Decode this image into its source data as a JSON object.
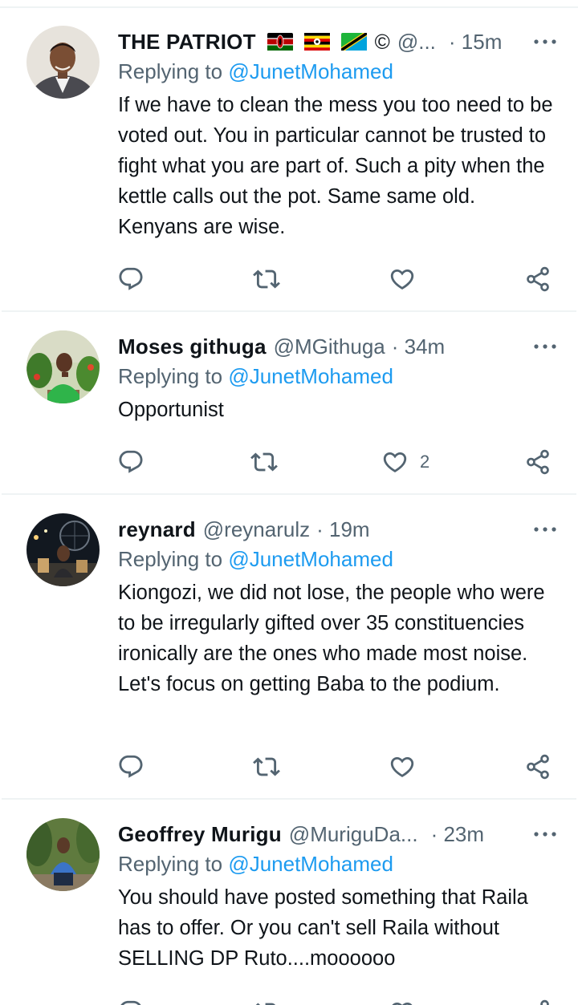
{
  "reply_prefix": "Replying to",
  "tweets": [
    {
      "name": "THE PATRIOT",
      "flags": [
        "kenya-flag",
        "uganda-flag",
        "tanzania-flag"
      ],
      "badge": "©",
      "handle": "@...",
      "time": "· 15m",
      "replying_to": "@JunetMohamed",
      "text": "If we have to clean the mess you too need to be voted out. You in particular cannot be trusted to fight what you are part of. Such a pity when the kettle calls out the pot. Same same old. Kenyans are wise.",
      "like_count": ""
    },
    {
      "name": "Moses githuga",
      "handle": "@MGithuga",
      "time": "· 34m",
      "replying_to": "@JunetMohamed",
      "text": "Opportunist",
      "like_count": "2"
    },
    {
      "name": "reynard",
      "handle": "@reynarulz",
      "time": "· 19m",
      "replying_to": "@JunetMohamed",
      "text": "Kiongozi, we did not lose, the people who were to be irregularly gifted over 35 constituencies ironically are the ones who made most noise. Let's focus on getting Baba to the podium.",
      "like_count": ""
    },
    {
      "name": "Geoffrey Murigu",
      "handle": "@MuriguDa...",
      "time": "· 23m",
      "replying_to": "@JunetMohamed",
      "text": "You should have posted something that Raila has to offer. Or you can't sell Raila without SELLING DP Ruto....moooooo",
      "like_count": ""
    }
  ],
  "icons": {
    "reply": "reply-icon",
    "retweet": "retweet-icon",
    "like": "heart-icon",
    "share": "share-icon",
    "more": "more-icon"
  },
  "colors": {
    "link": "#1d9bf0",
    "secondary_text": "#536471",
    "primary_text": "#0f1419",
    "divider": "#eff3f4"
  }
}
